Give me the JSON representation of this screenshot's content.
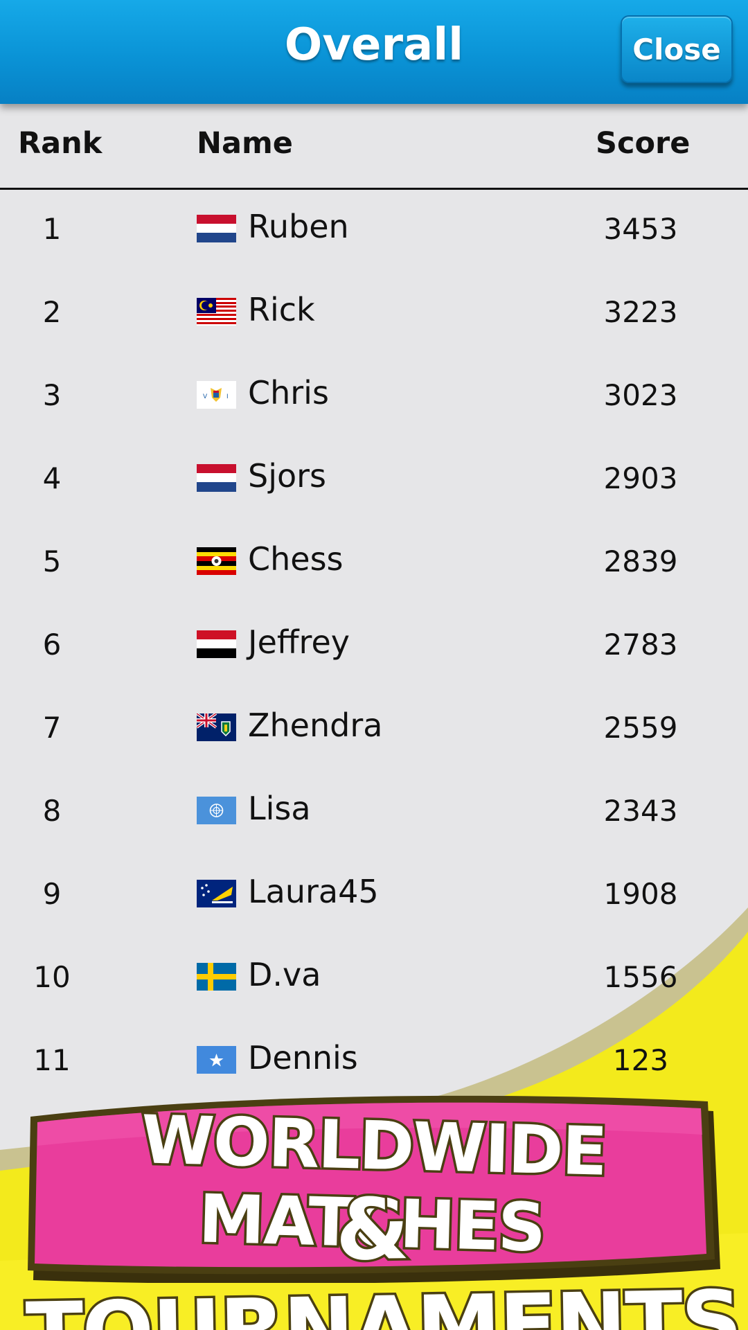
{
  "header": {
    "title": "Overall",
    "close_label": "Close"
  },
  "table": {
    "columns": {
      "rank": "Rank",
      "name": "Name",
      "score": "Score"
    },
    "rows": [
      {
        "rank": "1",
        "name": "Ruben",
        "score": "3453",
        "flag": "netherlands-flag-icon"
      },
      {
        "rank": "2",
        "name": "Rick",
        "score": "3223",
        "flag": "malaysia-flag-icon"
      },
      {
        "rank": "3",
        "name": "Chris",
        "score": "3023",
        "flag": "us-virgin-islands-flag-icon"
      },
      {
        "rank": "4",
        "name": "Sjors",
        "score": "2903",
        "flag": "netherlands-flag-icon"
      },
      {
        "rank": "5",
        "name": "Chess",
        "score": "2839",
        "flag": "uganda-flag-icon"
      },
      {
        "rank": "6",
        "name": "Jeffrey",
        "score": "2783",
        "flag": "yemen-flag-icon"
      },
      {
        "rank": "7",
        "name": "Zhendra",
        "score": "2559",
        "flag": "british-virgin-islands-flag-icon"
      },
      {
        "rank": "8",
        "name": "Lisa",
        "score": "2343",
        "flag": "united-nations-flag-icon"
      },
      {
        "rank": "9",
        "name": "Laura45",
        "score": "1908",
        "flag": "tokelau-flag-icon"
      },
      {
        "rank": "10",
        "name": "D.va",
        "score": "1556",
        "flag": "sweden-flag-icon"
      },
      {
        "rank": "11",
        "name": "Dennis",
        "score": "123",
        "flag": "somalia-flag-icon"
      }
    ]
  },
  "banner": {
    "line1": "WORLDWIDE MATCHES",
    "line2": "& TOURNAMENTS"
  },
  "colors": {
    "header_blue": "#0a93d6",
    "banner_pink": "#e93d9c",
    "banner_yellow": "#f6ea1a",
    "table_bg": "#e6e6e8"
  }
}
